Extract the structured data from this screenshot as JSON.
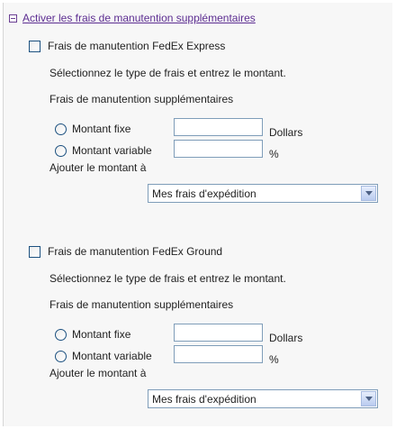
{
  "header": {
    "link_label": "Activer les frais de manutention supplémentaires"
  },
  "sections": [
    {
      "checkbox_label": "Frais de manutention FedEx Express",
      "checked": false,
      "instruction": "Sélectionnez le type de frais et entrez le montant.",
      "subheading": "Frais de manutention supplémentaires",
      "fixed_label": "Montant fixe",
      "fixed_value": "",
      "fixed_unit": "Dollars",
      "variable_label": "Montant variable",
      "variable_value": "",
      "variable_unit": "%",
      "add_label": "Ajouter le montant à",
      "add_selected": "Mes frais d'expédition"
    },
    {
      "checkbox_label": "Frais de manutention FedEx Ground",
      "checked": false,
      "instruction": "Sélectionnez le type de frais et entrez le montant.",
      "subheading": "Frais de manutention supplémentaires",
      "fixed_label": "Montant fixe",
      "fixed_value": "",
      "fixed_unit": "Dollars",
      "variable_label": "Montant variable",
      "variable_value": "",
      "variable_unit": "%",
      "add_label": "Ajouter le montant à",
      "add_selected": "Mes frais d'expédition"
    }
  ]
}
